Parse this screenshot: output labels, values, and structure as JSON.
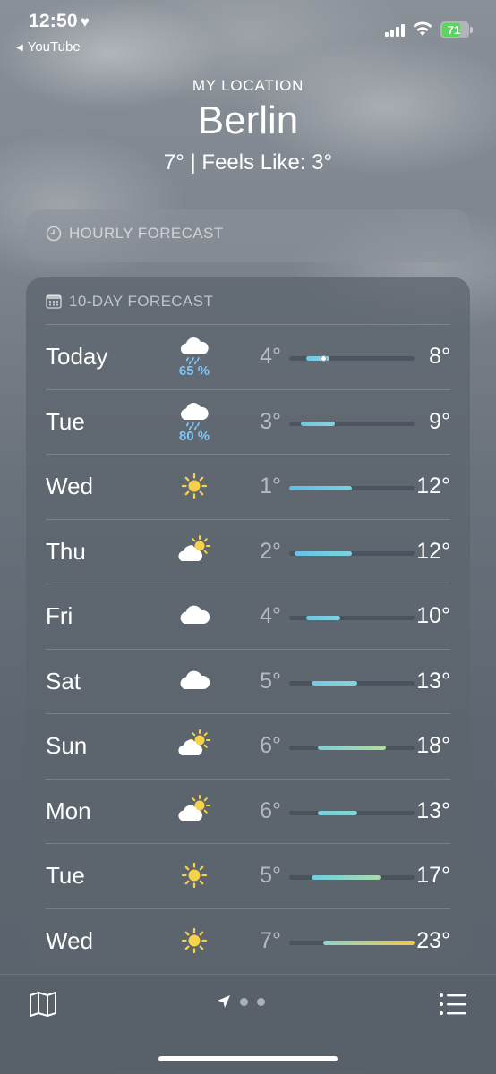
{
  "status_bar": {
    "time": "12:50",
    "time_badge": "♥",
    "back_app": "YouTube",
    "battery": "71",
    "battery_level": 0.71
  },
  "location": {
    "label": "MY LOCATION",
    "city": "Berlin",
    "temperature_line": "7°  |  Feels Like: 3°"
  },
  "hourly": {
    "title": "HOURLY FORECAST"
  },
  "ten_day": {
    "title": "10-DAY FORECAST",
    "range_min": 1,
    "range_max": 23,
    "current_temp": 7,
    "days": [
      {
        "day": "Today",
        "icon": "rain-cloud-icon",
        "precip": "65 %",
        "low": "4°",
        "high": "8°",
        "low_val": 4,
        "high_val": 8,
        "bar_colors": [
          "#6fc7e4",
          "#8fd0e6"
        ]
      },
      {
        "day": "Tue",
        "icon": "rain-cloud-icon",
        "precip": "80 %",
        "low": "3°",
        "high": "9°",
        "low_val": 3,
        "high_val": 9,
        "bar_colors": [
          "#6fc7e4",
          "#8ad2e0"
        ]
      },
      {
        "day": "Wed",
        "icon": "sun-icon",
        "precip": "",
        "low": "1°",
        "high": "12°",
        "low_val": 1,
        "high_val": 12,
        "bar_colors": [
          "#62bde6",
          "#79d1df"
        ]
      },
      {
        "day": "Thu",
        "icon": "partly-cloudy-icon",
        "precip": "",
        "low": "2°",
        "high": "12°",
        "low_val": 2,
        "high_val": 12,
        "bar_colors": [
          "#66c2e6",
          "#7dd3dd"
        ]
      },
      {
        "day": "Fri",
        "icon": "cloud-icon",
        "precip": "",
        "low": "4°",
        "high": "10°",
        "low_val": 4,
        "high_val": 10,
        "bar_colors": [
          "#6fc7e4",
          "#82d1e0"
        ]
      },
      {
        "day": "Sat",
        "icon": "cloud-icon",
        "precip": "",
        "low": "5°",
        "high": "13°",
        "low_val": 5,
        "high_val": 13,
        "bar_colors": [
          "#72cbe2",
          "#85d5d8"
        ]
      },
      {
        "day": "Sun",
        "icon": "partly-cloudy-icon",
        "precip": "",
        "low": "6°",
        "high": "18°",
        "low_val": 6,
        "high_val": 18,
        "bar_colors": [
          "#7acfde",
          "#b6dc9a"
        ]
      },
      {
        "day": "Mon",
        "icon": "partly-cloudy-icon",
        "precip": "",
        "low": "6°",
        "high": "13°",
        "low_val": 6,
        "high_val": 13,
        "bar_colors": [
          "#7acfde",
          "#88d6d2"
        ]
      },
      {
        "day": "Tue",
        "icon": "sun-icon",
        "precip": "",
        "low": "5°",
        "high": "17°",
        "low_val": 5,
        "high_val": 17,
        "bar_colors": [
          "#72cbe2",
          "#a8dcaa"
        ]
      },
      {
        "day": "Wed",
        "icon": "sun-icon",
        "precip": "",
        "low": "7°",
        "high": "23°",
        "low_val": 7,
        "high_val": 23,
        "bar_colors": [
          "#8ed6c8",
          "#f2c94c"
        ]
      }
    ]
  },
  "bottom_bar": {
    "page_count": 2,
    "current_page": 0
  }
}
